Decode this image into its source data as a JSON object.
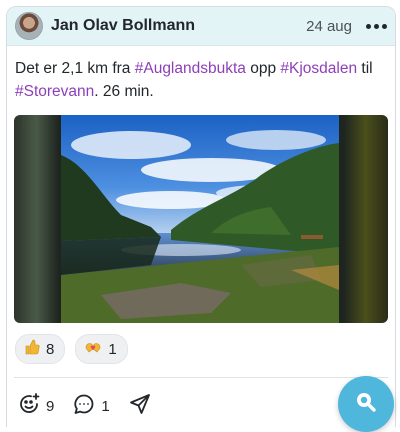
{
  "post": {
    "author": "Jan Olav Bollmann",
    "date": "24 aug",
    "text": {
      "t1": "Det er 2,1 km fra ",
      "tag1": "#Auglandsbukta",
      "t2": " opp ",
      "tag2": "#Kjosdalen",
      "t3": " til",
      "tag3": "#Storevann",
      "t4": ". 26 min."
    }
  },
  "reactions": [
    {
      "icon": "thumbs-up-icon",
      "count": "8"
    },
    {
      "icon": "heart-hands-icon",
      "count": "1"
    }
  ],
  "actions": {
    "add_reaction_count": "9",
    "comment_count": "1"
  },
  "colors": {
    "header_bg": "#e3f4f6",
    "hashtag": "#8e3fb8",
    "fab": "#4fb6dc"
  }
}
